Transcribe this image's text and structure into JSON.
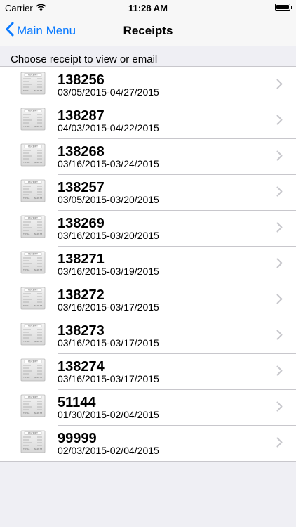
{
  "status_bar": {
    "carrier": "Carrier",
    "time": "11:28 AM"
  },
  "nav": {
    "back_label": "Main Menu",
    "title": "Receipts"
  },
  "section_header": "Choose receipt to view or email",
  "receipt_thumb": {
    "header": "RECEIPT",
    "total_label": "TOTAL",
    "total_value": "$126.78"
  },
  "receipts": [
    {
      "number": "138256",
      "dates": "03/05/2015-04/27/2015"
    },
    {
      "number": "138287",
      "dates": "04/03/2015-04/22/2015"
    },
    {
      "number": "138268",
      "dates": "03/16/2015-03/24/2015"
    },
    {
      "number": "138257",
      "dates": "03/05/2015-03/20/2015"
    },
    {
      "number": "138269",
      "dates": "03/16/2015-03/20/2015"
    },
    {
      "number": "138271",
      "dates": "03/16/2015-03/19/2015"
    },
    {
      "number": "138272",
      "dates": "03/16/2015-03/17/2015"
    },
    {
      "number": "138273",
      "dates": "03/16/2015-03/17/2015"
    },
    {
      "number": "138274",
      "dates": "03/16/2015-03/17/2015"
    },
    {
      "number": "51144",
      "dates": "01/30/2015-02/04/2015"
    },
    {
      "number": "99999",
      "dates": "02/03/2015-02/04/2015"
    }
  ],
  "colors": {
    "tint": "#0a7aff",
    "separator": "#c8c7cc",
    "background": "#efeff4",
    "chevron": "#c7c7cc"
  },
  "icons": {
    "back": "chevron-left-icon",
    "disclosure": "chevron-right-icon",
    "wifi": "wifi-icon",
    "battery": "battery-icon",
    "receipt": "receipt-icon"
  }
}
